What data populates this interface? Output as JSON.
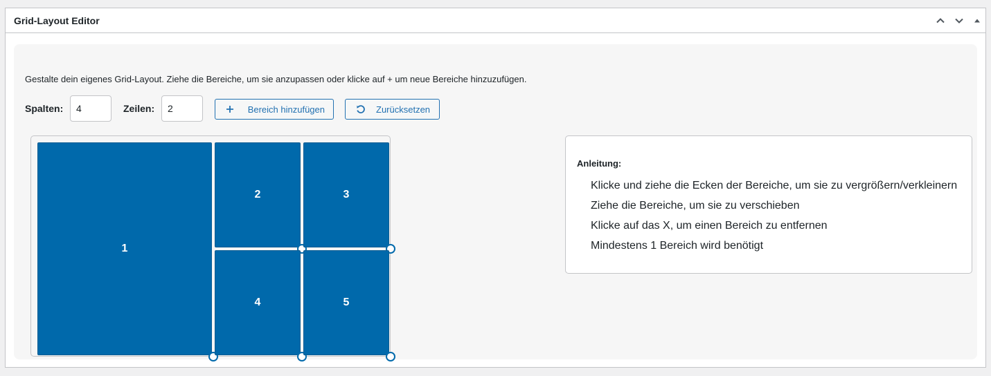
{
  "panel": {
    "title": "Grid-Layout Editor",
    "controls": {
      "move_up": "chevron-up-icon",
      "move_down": "chevron-down-icon",
      "toggle": "triangle-up-icon"
    }
  },
  "editor": {
    "description": "Gestalte dein eigenes Grid-Layout. Ziehe die Bereiche, um sie anzupassen oder klicke auf + um neue Bereiche hinzuzufügen.",
    "columns_label": "Spalten:",
    "columns_value": "4",
    "rows_label": "Zeilen:",
    "rows_value": "2",
    "add_button": {
      "icon": "plus-icon",
      "label": "Bereich hinzufügen"
    },
    "reset_button": {
      "icon": "reset-icon",
      "label": "Zurücksetzen"
    },
    "colors": {
      "area": "#0069ab",
      "accent": "#2271b1"
    },
    "areas": [
      {
        "label": "1",
        "col": 1,
        "row": 1,
        "colspan": 2,
        "rowspan": 2
      },
      {
        "label": "2",
        "col": 3,
        "row": 1,
        "colspan": 1,
        "rowspan": 1
      },
      {
        "label": "3",
        "col": 4,
        "row": 1,
        "colspan": 1,
        "rowspan": 1
      },
      {
        "label": "4",
        "col": 3,
        "row": 2,
        "colspan": 1,
        "rowspan": 1
      },
      {
        "label": "5",
        "col": 4,
        "row": 2,
        "colspan": 1,
        "rowspan": 1
      }
    ]
  },
  "instructions": {
    "title": "Anleitung:",
    "items": [
      "Klicke und ziehe die Ecken der Bereiche, um sie zu vergrößern/verkleinern",
      "Ziehe die Bereiche, um sie zu verschieben",
      "Klicke auf das X, um einen Bereich zu entfernen",
      "Mindestens 1 Bereich wird benötigt"
    ]
  }
}
